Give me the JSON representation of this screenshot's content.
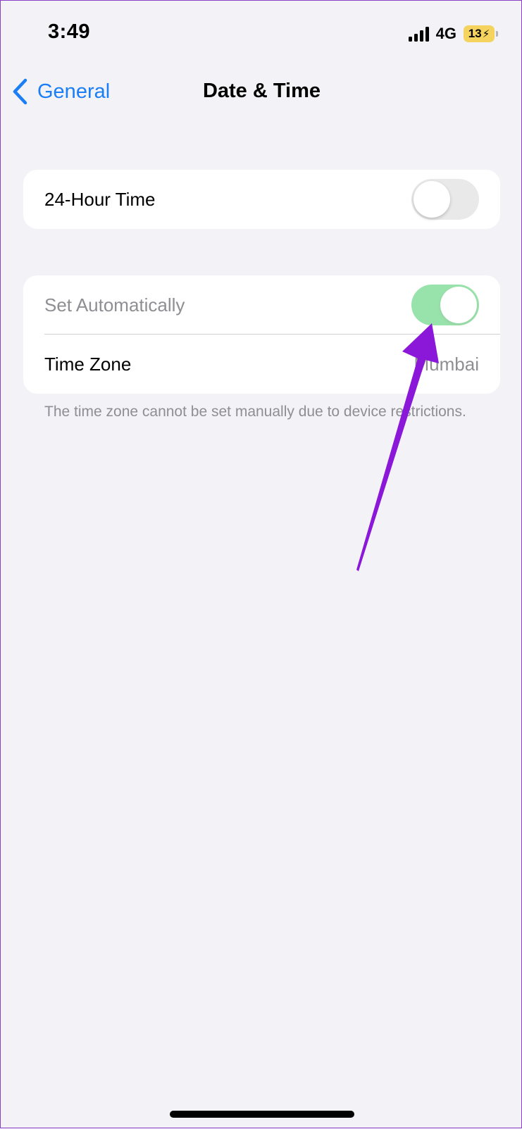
{
  "status_bar": {
    "time": "3:49",
    "network": "4G",
    "battery": "13",
    "battery_color": "#f4d35e"
  },
  "nav": {
    "back_label": "General",
    "title": "Date & Time",
    "accent_color": "#1a7ef5"
  },
  "groups": {
    "time_format": {
      "label": "24-Hour Time",
      "toggle_on": false
    },
    "auto": {
      "set_automatically_label": "Set Automatically",
      "set_automatically_on": true,
      "set_automatically_disabled": true,
      "toggle_color": "#34c759",
      "time_zone_label": "Time Zone",
      "time_zone_value": "Mumbai"
    }
  },
  "footnote": "The time zone cannot be set manually due to device restrictions.",
  "annotation": {
    "color": "#8b17d8"
  }
}
